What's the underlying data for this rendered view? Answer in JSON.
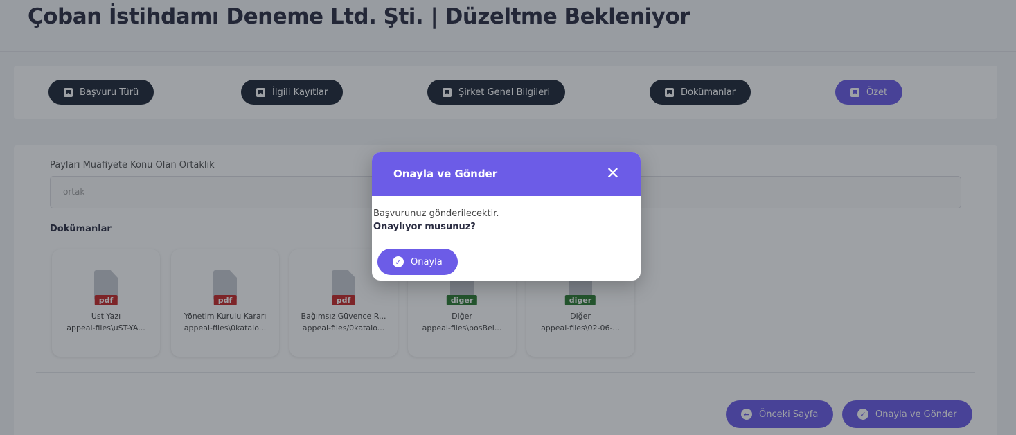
{
  "header": {
    "title": "Çoban İstihdamı Deneme Ltd. Şti. | Düzeltme Bekleniyor"
  },
  "steps": [
    {
      "label": "Başvuru Türü",
      "icon": "bookmark-icon",
      "active": false
    },
    {
      "label": "İlgili Kayıtlar",
      "icon": "bookmark-icon",
      "active": false
    },
    {
      "label": "Şirket Genel Bilgileri",
      "icon": "bookmark-icon",
      "active": false
    },
    {
      "label": "Dokümanlar",
      "icon": "bookmark-icon",
      "active": false
    },
    {
      "label": "Özet",
      "icon": "bookmark-icon",
      "active": true
    }
  ],
  "form": {
    "partnership_label": "Payları Muafiyete Konu Olan Ortaklık",
    "partnership_value": "ortak"
  },
  "documents": {
    "heading": "Dokümanlar",
    "items": [
      {
        "type": "pdf",
        "title": "Üst Yazı",
        "path": "appeal-files\\uST-YA..."
      },
      {
        "type": "pdf",
        "title": "Yönetim Kurulu Kararı",
        "path": "appeal-files\\0katalo..."
      },
      {
        "type": "pdf",
        "title": "Bağımsız Güvence R...",
        "path": "appeal-files/0katalo..."
      },
      {
        "type": "diger",
        "title": "Diğer",
        "path": "appeal-files\\bosBel..."
      },
      {
        "type": "diger",
        "title": "Diğer",
        "path": "appeal-files\\02-06-..."
      }
    ]
  },
  "actions": {
    "prev_label": "Önceki Sayfa",
    "submit_label": "Onayla ve Gönder"
  },
  "modal": {
    "title": "Onayla ve Gönder",
    "message": "Başvurunuz gönderilecektir.",
    "question": "Onaylıyor musunuz?",
    "confirm_label": "Onayla",
    "close_symbol": "✕"
  },
  "colors": {
    "primary": "#6c5ce7",
    "dark_button": "#1f2937",
    "pdf_badge": "#c62828",
    "other_badge": "#2e7d32"
  }
}
